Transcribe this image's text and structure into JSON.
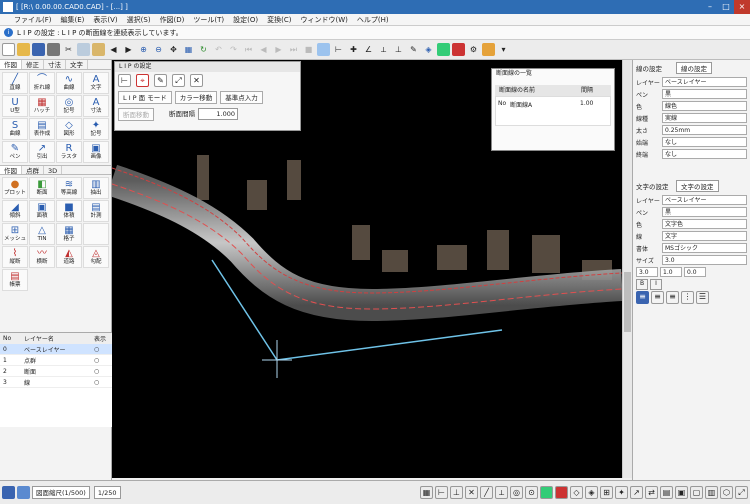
{
  "window": {
    "title": "[ [R:\\ 0.00.00.CAD0.CAD] - [...] ]"
  },
  "menu": [
    "ファイル(F)",
    "編集(E)",
    "表示(V)",
    "選択(S)",
    "作図(D)",
    "ツール(T)",
    "設定(O)",
    "変換(C)",
    "ウィンドウ(W)",
    "ヘルプ(H)"
  ],
  "info": {
    "message": "L I P の設定 : L I P の断面線を連続表示しています。"
  },
  "left": {
    "tabs1": [
      "作図",
      "修正",
      "寸法",
      "文字"
    ],
    "tools1": [
      {
        "name": "line-tool",
        "label": "直線",
        "icon": "╱",
        "color": "#2a5db0"
      },
      {
        "name": "polyline-tool",
        "label": "折れ線",
        "icon": "⌒",
        "color": "#2a5db0"
      },
      {
        "name": "curve-tool",
        "label": "曲線",
        "icon": "∿",
        "color": "#2a5db0"
      },
      {
        "name": "text-tool",
        "label": "文字",
        "icon": "A",
        "color": "#2a5db0"
      },
      {
        "name": "u-shape-tool",
        "label": "U型",
        "icon": "U",
        "color": "#2a5db0"
      },
      {
        "name": "hatch-tool",
        "label": "ハッチ",
        "icon": "▦",
        "color": "#c03030"
      },
      {
        "name": "symbol-tool",
        "label": "記号",
        "icon": "◎",
        "color": "#2a5db0"
      },
      {
        "name": "dimension-tool",
        "label": "寸法",
        "icon": "A",
        "color": "#2a5db0"
      },
      {
        "name": "spline-tool",
        "label": "曲線",
        "icon": "S",
        "color": "#2a5db0"
      },
      {
        "name": "table-tool",
        "label": "表作成",
        "icon": "▤",
        "color": "#2a5db0"
      },
      {
        "name": "figure-tool",
        "label": "図形",
        "icon": "◇",
        "color": "#2a5db0"
      },
      {
        "name": "mark-tool",
        "label": "記号",
        "icon": "✦",
        "color": "#2a5db0"
      },
      {
        "name": "pen-tool",
        "label": "ペン",
        "icon": "✎",
        "color": "#2a5db0"
      },
      {
        "name": "leader-tool",
        "label": "引出",
        "icon": "↗",
        "color": "#2a5db0"
      },
      {
        "name": "raster-tool",
        "label": "ラスタ",
        "icon": "R",
        "color": "#2a5db0"
      },
      {
        "name": "image-tool",
        "label": "画像",
        "icon": "▣",
        "color": "#2a5db0"
      }
    ],
    "tabs2": [
      "作図",
      "点群",
      "3D"
    ],
    "tools2": [
      {
        "name": "plot-tool",
        "label": "プロット",
        "icon": "●",
        "color": "#d07020"
      },
      {
        "name": "section-tool",
        "label": "断面",
        "icon": "◧",
        "color": "#3a9a3a"
      },
      {
        "name": "contour-tool",
        "label": "等高線",
        "icon": "≋",
        "color": "#2a5db0"
      },
      {
        "name": "trace-tool",
        "label": "抽出",
        "icon": "▥",
        "color": "#2a5db0"
      },
      {
        "name": "slope-tool",
        "label": "傾斜",
        "icon": "◢",
        "color": "#2a5db0"
      },
      {
        "name": "area-tool",
        "label": "面積",
        "icon": "▣",
        "color": "#2a5db0"
      },
      {
        "name": "volume-tool",
        "label": "体積",
        "icon": "■",
        "color": "#2a5db0"
      },
      {
        "name": "measure-tool",
        "label": "計測",
        "icon": "▤",
        "color": "#2a5db0"
      },
      {
        "name": "mesh-tool",
        "label": "メッシュ",
        "icon": "⊞",
        "color": "#2a5db0"
      },
      {
        "name": "tin-tool",
        "label": "TIN",
        "icon": "△",
        "color": "#2a5db0"
      },
      {
        "name": "grid-tool",
        "label": "格子",
        "icon": "▦",
        "color": "#2a5db0"
      },
      {
        "name": "blank-tool",
        "label": "",
        "icon": "",
        "color": "#2a5db0"
      },
      {
        "name": "profile-tool",
        "label": "縦断",
        "icon": "⌇",
        "color": "#c03030"
      },
      {
        "name": "cross-tool",
        "label": "横断",
        "icon": "〰",
        "color": "#c03030"
      },
      {
        "name": "road-tool",
        "label": "道路",
        "icon": "◭",
        "color": "#c03030"
      },
      {
        "name": "slope-calc-tool",
        "label": "勾配",
        "icon": "◬",
        "color": "#c03030"
      },
      {
        "name": "report-tool",
        "label": "帳票",
        "icon": "▤",
        "color": "#c03030"
      }
    ],
    "layers": {
      "headers": [
        "No",
        "レイヤー名",
        "表示"
      ],
      "rows": [
        {
          "no": "0",
          "name": "ベースレイヤー",
          "vis": "○"
        },
        {
          "no": "1",
          "name": "点群",
          "vis": "○"
        },
        {
          "no": "2",
          "name": "断面",
          "vis": "○"
        },
        {
          "no": "3",
          "name": "線",
          "vis": "○"
        }
      ]
    }
  },
  "floatpanel": {
    "title": "L I P の設定",
    "btn1": "L I P 面 モード",
    "btn2": "カラー移動",
    "btn3": "基準点入力",
    "btn4": "断面移動",
    "pitch_label": "断面間隔",
    "pitch_value": "1.000"
  },
  "dialog": {
    "title": "断面線の一覧",
    "col1": "断面線の名前",
    "col2": "間隔",
    "row_no": "No",
    "row_name": "断面線A",
    "row_val": "1.00"
  },
  "right": {
    "sec1_label": "線の設定",
    "sec1_btn": "線の設定",
    "rows1": [
      {
        "label": "レイヤー",
        "value": "ベースレイヤー"
      },
      {
        "label": "ペン",
        "value": "黒"
      },
      {
        "label": "色",
        "value": "線色"
      },
      {
        "label": "線種",
        "value": "実線"
      },
      {
        "label": "太さ",
        "value": "0.25mm"
      },
      {
        "label": "始端",
        "value": "なし"
      },
      {
        "label": "終端",
        "value": "なし"
      }
    ],
    "sec2_label": "文字の設定",
    "sec2_btn": "文字の設定",
    "rows2": [
      {
        "label": "レイヤー",
        "value": "ベースレイヤー"
      },
      {
        "label": "ペン",
        "value": "黒"
      },
      {
        "label": "色",
        "value": "文字色"
      },
      {
        "label": "線",
        "value": "文字"
      },
      {
        "label": "書体",
        "value": "MSゴシック"
      },
      {
        "label": "サイズ",
        "value": "3.0"
      }
    ],
    "size_values": [
      "3.0",
      "1.0",
      "0.0"
    ],
    "style_btns": [
      "B",
      "I"
    ]
  },
  "status": {
    "sel1": "図面縮尺(1/500)",
    "sel2": "1/250"
  }
}
